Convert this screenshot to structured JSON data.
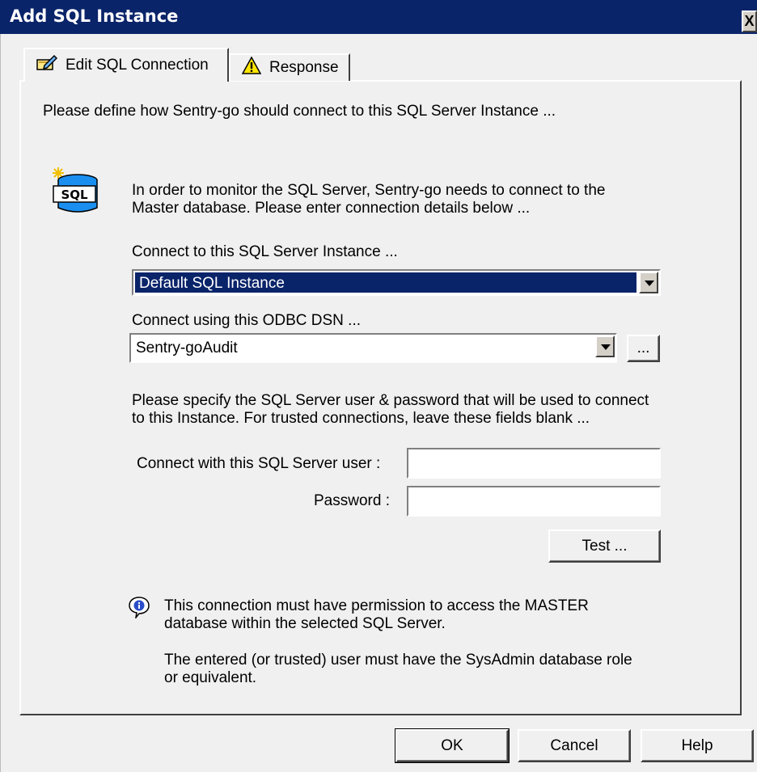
{
  "window": {
    "title": "Add SQL Instance",
    "close_label": "X"
  },
  "tabs": [
    {
      "label": "Edit SQL Connection",
      "icon": "edit-connection-icon",
      "active": true
    },
    {
      "label": "Response",
      "icon": "warning-icon",
      "active": false
    }
  ],
  "main": {
    "intro": "Please define how Sentry-go should connect to this SQL Server Instance ...",
    "monitor_text_1": "In order to monitor the SQL Server, Sentry-go needs to connect to the",
    "monitor_text_2": "Master database. Please enter connection details below ...",
    "sql_icon_text": "SQL",
    "instance_label": "Connect to this SQL Server Instance ...",
    "instance_value": "Default SQL Instance",
    "dsn_label": "Connect using this ODBC DSN ...",
    "dsn_value": "Sentry-goAudit",
    "browse_label": "...",
    "cred_text_1": "Please specify the SQL Server user & password that will be used to connect",
    "cred_text_2": "to this Instance. For trusted connections, leave these fields blank ...",
    "user_label": "Connect with this SQL Server user :",
    "user_value": "",
    "password_label": "Password :",
    "password_value": "",
    "test_label": "Test ...",
    "info_1a": "This connection must have permission to access the MASTER",
    "info_1b": "database within the selected SQL Server.",
    "info_2a": "The entered (or trusted) user must have the SysAdmin database role",
    "info_2b": "or equivalent."
  },
  "footer": {
    "ok_label": "OK",
    "cancel_label": "Cancel",
    "help_label": "Help"
  }
}
